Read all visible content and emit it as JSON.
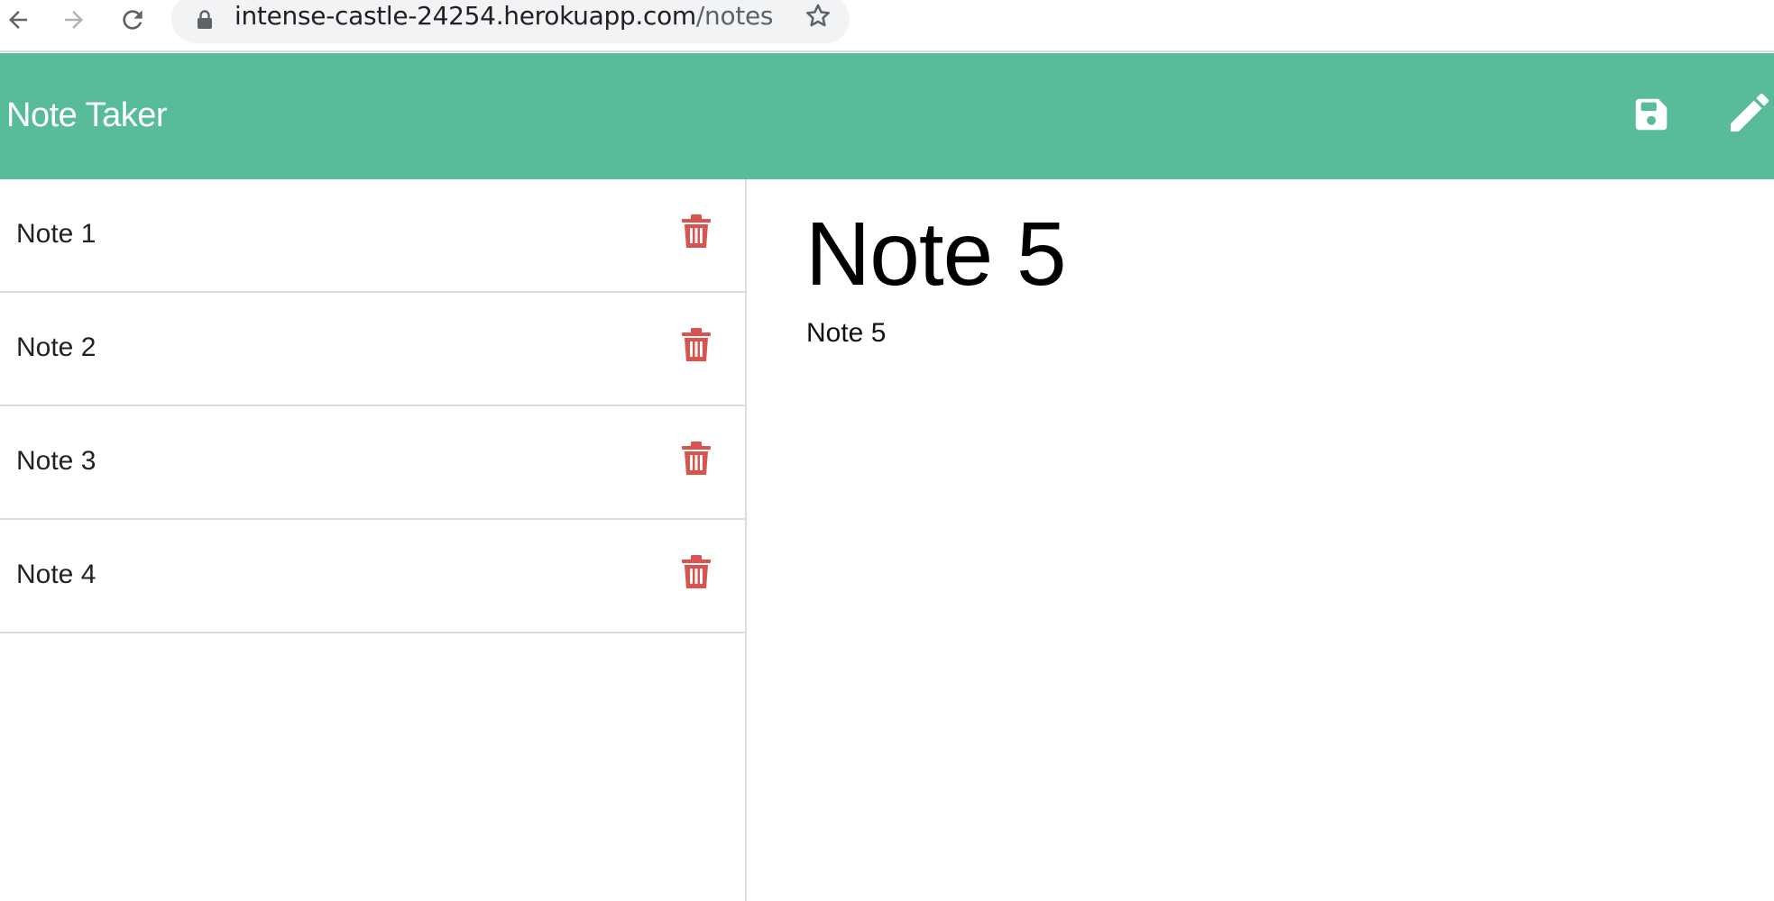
{
  "browser": {
    "url_domain": "intense-castle-24254.herokuapp.com",
    "url_path": "/notes"
  },
  "header": {
    "brand": "Note Taker",
    "save_icon": "save-icon",
    "edit_icon": "pencil-icon"
  },
  "notes": [
    {
      "title": "Note 1"
    },
    {
      "title": "Note 2"
    },
    {
      "title": "Note 3"
    },
    {
      "title": "Note 4"
    }
  ],
  "editor": {
    "title": "Note 5",
    "text": "Note 5"
  },
  "colors": {
    "header": "#58bb9c",
    "trash": "#d9534f"
  }
}
